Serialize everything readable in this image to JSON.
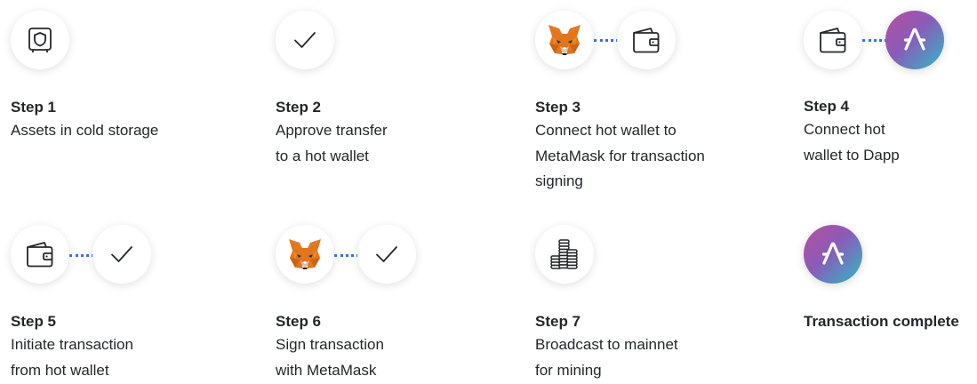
{
  "steps": [
    {
      "title": "Step 1",
      "desc": [
        "Assets in cold storage"
      ]
    },
    {
      "title": "Step 2",
      "desc": [
        "Approve transfer",
        "to a hot wallet"
      ]
    },
    {
      "title": "Step 3",
      "desc": [
        "Connect hot wallet to",
        "MetaMask for transaction",
        "signing"
      ]
    },
    {
      "title": "Step 4",
      "desc": [
        "Connect hot",
        "wallet to Dapp"
      ]
    },
    {
      "title": "Step 5",
      "desc": [
        "Initiate transaction",
        "from hot wallet"
      ]
    },
    {
      "title": "Step 6",
      "desc": [
        "Sign transaction",
        "with MetaMask"
      ]
    },
    {
      "title": "Step 7",
      "desc": [
        "Broadcast to mainnet",
        "for mining"
      ]
    },
    {
      "title": "Transaction complete",
      "desc": []
    }
  ],
  "colors": {
    "connector_dots": "#3a6ee8",
    "aave_gradient": [
      "#b6509e",
      "#2ebac6"
    ],
    "fox_orange": "#e2761b",
    "text": "#24272a"
  },
  "icons": {
    "step1": [
      "vault-icon"
    ],
    "step2": [
      "checkmark-icon"
    ],
    "step3": [
      "metamask-fox-icon",
      "wallet-icon"
    ],
    "step4": [
      "wallet-icon",
      "aave-logo-icon"
    ],
    "step5": [
      "wallet-icon",
      "checkmark-icon"
    ],
    "step6": [
      "metamask-fox-icon",
      "checkmark-icon"
    ],
    "step7": [
      "coin-stacks-icon"
    ],
    "step8": [
      "aave-logo-icon"
    ]
  }
}
